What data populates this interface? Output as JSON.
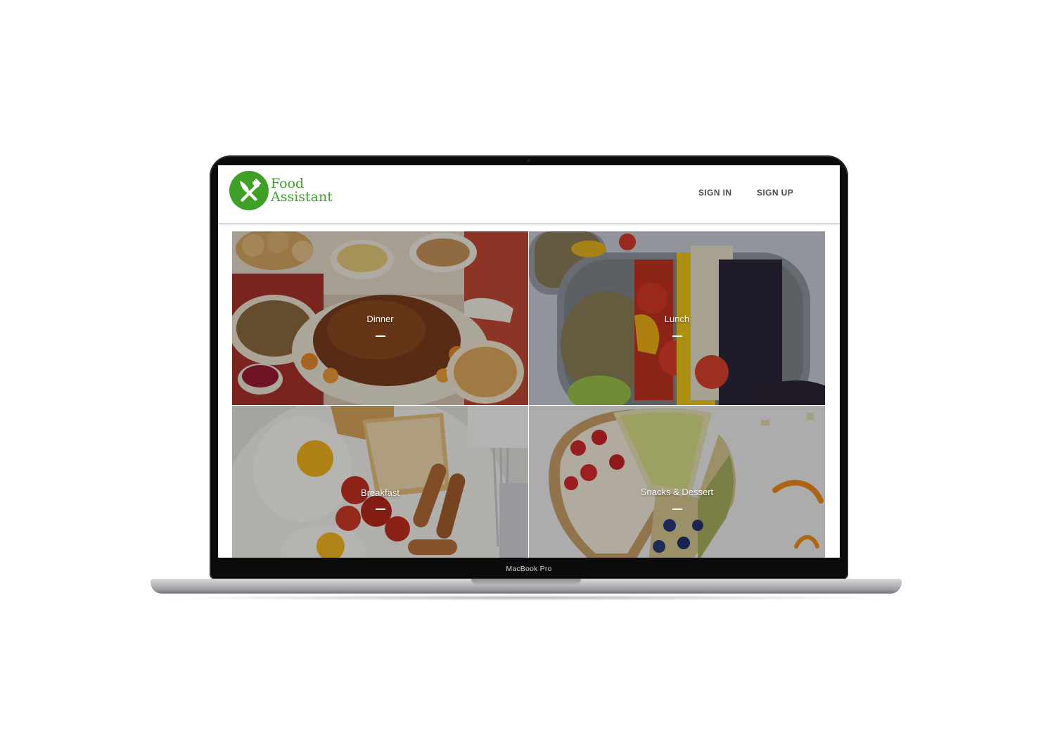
{
  "device": {
    "model_label": "MacBook Pro"
  },
  "site": {
    "brand": {
      "line1": "Food",
      "line2": "Assistant",
      "logo_icon": "fork-knife-icon",
      "brand_color": "#3f9f26"
    },
    "nav": {
      "sign_in": "SIGN IN",
      "sign_up": "SIGN UP"
    },
    "categories": [
      {
        "label": "Dinner"
      },
      {
        "label": "Lunch"
      },
      {
        "label": "Breakfast"
      },
      {
        "label": "Snacks & Dessert"
      }
    ]
  }
}
